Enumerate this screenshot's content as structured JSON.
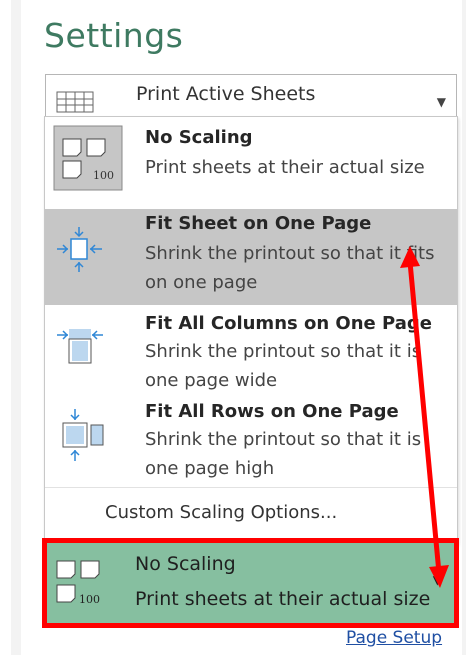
{
  "page_title": "Settings",
  "print_what": {
    "label": "Print Active Sheets"
  },
  "scaling_menu": {
    "items": [
      {
        "title": "No Scaling",
        "desc": "Print sheets at their actual size",
        "badge": "100",
        "highlighted": false
      },
      {
        "title": "Fit Sheet on One Page",
        "desc": "Shrink the printout so that it fits on one page",
        "highlighted": true
      },
      {
        "title": "Fit All Columns on One Page",
        "desc": "Shrink the printout so that it is one page wide",
        "highlighted": false
      },
      {
        "title": "Fit All Rows on One Page",
        "desc": "Shrink the printout so that it is one page high",
        "highlighted": false
      }
    ],
    "custom_label": "Custom Scaling Options..."
  },
  "scaling_selected": {
    "title": "No Scaling",
    "desc": "Print sheets at their actual size",
    "badge": "100"
  },
  "page_setup_link": "Page Setup",
  "colors": {
    "accent_green": "#86bfa0",
    "highlight_gray": "#c6c6c6",
    "annotation_red": "#ff0000",
    "icon_blue": "#2f87d6"
  }
}
